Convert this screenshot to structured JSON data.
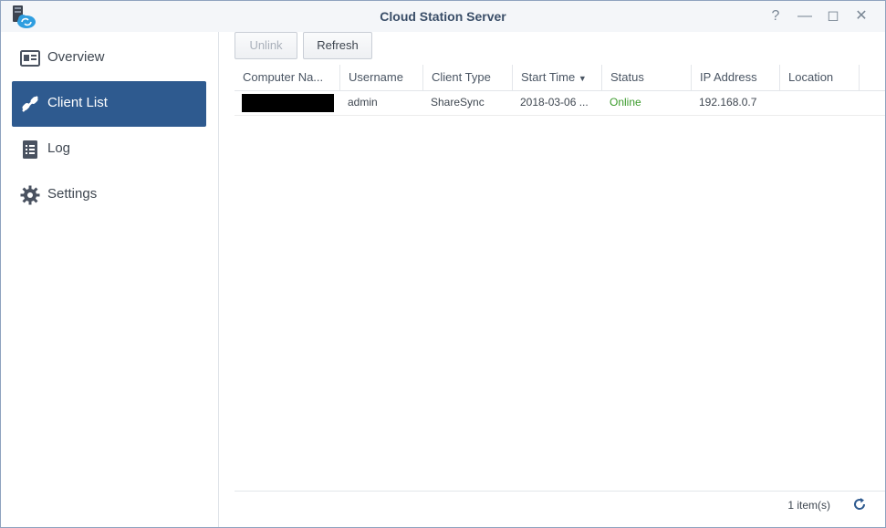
{
  "window": {
    "title": "Cloud Station Server",
    "controls": {
      "help": "?",
      "minimize": "—",
      "maximize": "◻",
      "close": "✕"
    }
  },
  "sidebar": {
    "items": [
      {
        "label": "Overview",
        "icon": "overview-icon",
        "active": false
      },
      {
        "label": "Client List",
        "icon": "client-list-icon",
        "active": true
      },
      {
        "label": "Log",
        "icon": "log-icon",
        "active": false
      },
      {
        "label": "Settings",
        "icon": "gear-icon",
        "active": false
      }
    ]
  },
  "toolbar": {
    "unlink_label": "Unlink",
    "refresh_label": "Refresh"
  },
  "table": {
    "columns": [
      "Computer Na...",
      "Username",
      "Client Type",
      "Start Time",
      "Status",
      "IP Address",
      "Location"
    ],
    "sort_column": "Start Time",
    "rows": [
      {
        "computer_name": "",
        "username": "admin",
        "client_type": "ShareSync",
        "start_time": "2018-03-06 ...",
        "status": "Online",
        "ip_address": "192.168.0.7",
        "location": ""
      }
    ]
  },
  "footer": {
    "count_label": "1 item(s)"
  },
  "colors": {
    "accent": "#2e5a8f",
    "online": "#3a9a2a",
    "title": "#3a4e68"
  }
}
